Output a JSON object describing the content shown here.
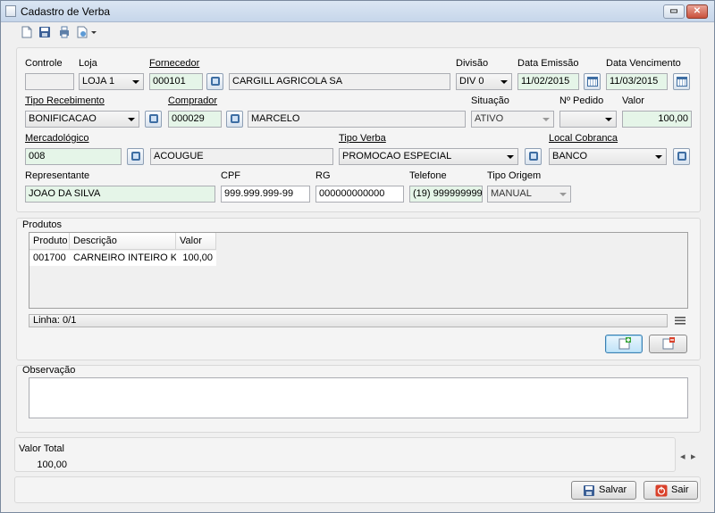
{
  "window": {
    "title": "Cadastro de Verba"
  },
  "toolbar": {
    "icons": [
      "new-document-icon",
      "save-icon",
      "print-icon",
      "export-icon"
    ]
  },
  "form": {
    "controle": {
      "label": "Controle",
      "value": ""
    },
    "loja": {
      "label": "Loja",
      "value": "LOJA 1"
    },
    "fornecedor": {
      "label": "Fornecedor",
      "code": "000101",
      "name": "CARGILL AGRICOLA SA"
    },
    "divisao": {
      "label": "Divisão",
      "value": "DIV 0"
    },
    "data_emissao": {
      "label": "Data Emissão",
      "value": "11/02/2015"
    },
    "data_vencimento": {
      "label": "Data Vencimento",
      "value": "11/03/2015"
    },
    "tipo_recebimento": {
      "label": "Tipo Recebimento",
      "value": "BONIFICACAO"
    },
    "comprador": {
      "label": "Comprador",
      "code": "000029",
      "name": "MARCELO"
    },
    "situacao": {
      "label": "Situação",
      "value": "ATIVO"
    },
    "n_pedido": {
      "label": "Nº Pedido",
      "value": ""
    },
    "valor": {
      "label": "Valor",
      "value": "100,00"
    },
    "mercadologico": {
      "label": "Mercadológico",
      "code": "008",
      "name": "ACOUGUE"
    },
    "tipo_verba": {
      "label": "Tipo Verba",
      "value": "PROMOCAO ESPECIAL"
    },
    "local_cobranca": {
      "label": "Local Cobranca",
      "value": "BANCO"
    },
    "representante": {
      "label": "Representante",
      "value": "JOAO DA SILVA"
    },
    "cpf": {
      "label": "CPF",
      "value": "999.999.999-99"
    },
    "rg": {
      "label": "RG",
      "value": "000000000000"
    },
    "telefone": {
      "label": "Telefone",
      "value": "(19) 999999999"
    },
    "tipo_origem": {
      "label": "Tipo Origem",
      "value": "MANUAL"
    }
  },
  "produtos": {
    "title": "Produtos",
    "columns": [
      "Produto",
      "Descrição",
      "Valor"
    ],
    "rows": [
      {
        "produto": "001700",
        "descricao": "CARNEIRO INTEIRO KG",
        "valor": "100,00"
      }
    ],
    "status": "Linha: 0/1"
  },
  "observacao": {
    "label": "Observação",
    "value": ""
  },
  "totais": {
    "label": "Valor Total",
    "value": "100,00"
  },
  "footer": {
    "save_label": "Salvar",
    "exit_label": "Sair"
  },
  "colors": {
    "required_field": "#e5f5e8",
    "titlebar": "#c6d6ea",
    "exit_icon": "#d9412b"
  }
}
